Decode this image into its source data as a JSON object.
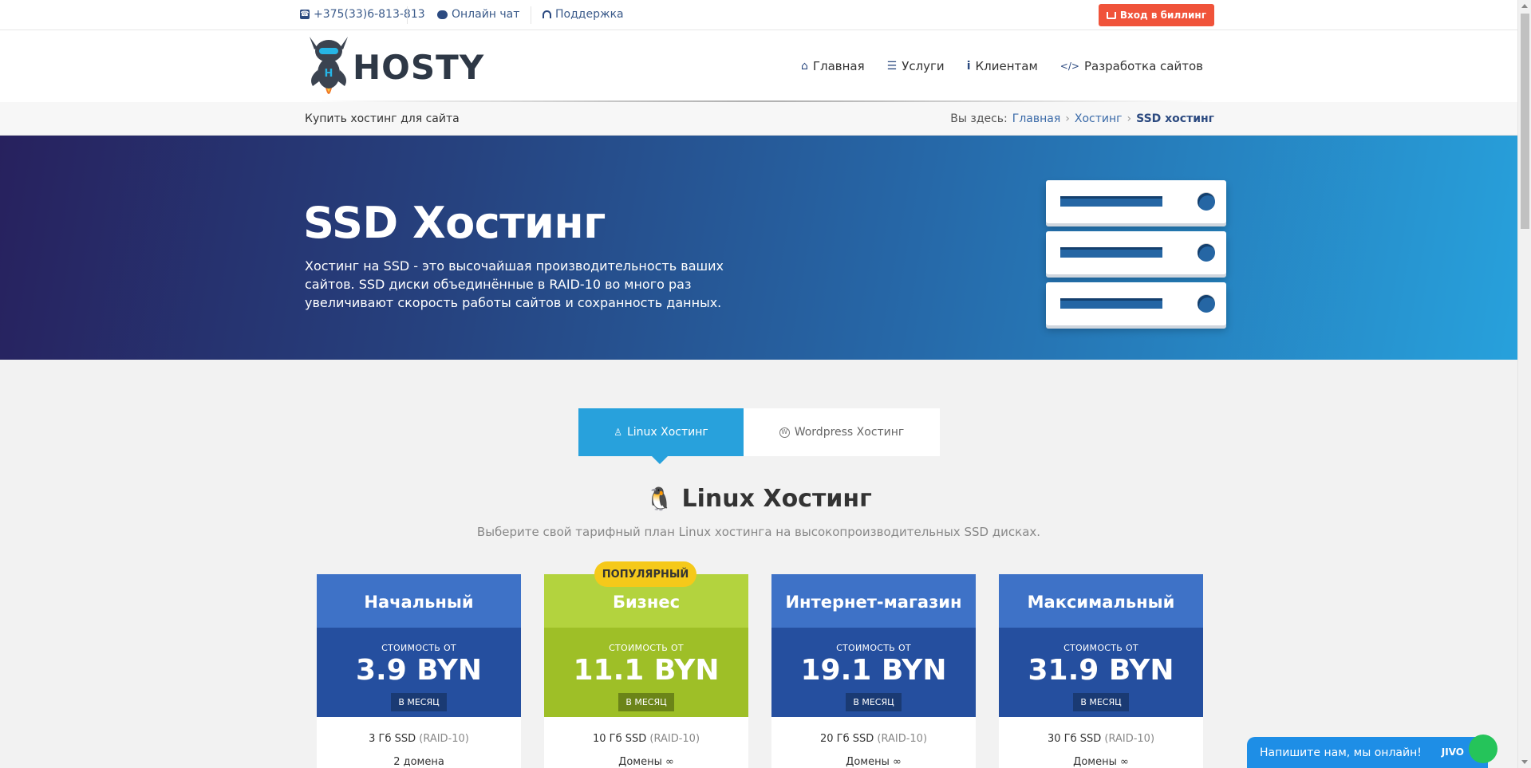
{
  "topbar": {
    "phone": "+375(33)6-813-813",
    "chat": "Онлайн чат",
    "support": "Поддержка",
    "billing": "Вход в биллинг"
  },
  "header": {
    "logo_text": "HOSTY",
    "nav": [
      {
        "label": "Главная",
        "icon": "home-icon"
      },
      {
        "label": "Услуги",
        "icon": "list-icon"
      },
      {
        "label": "Клиентам",
        "icon": "info-icon"
      },
      {
        "label": "Разработка сайтов",
        "icon": "code-icon"
      }
    ]
  },
  "breadcrumb": {
    "page_name": "Купить хостинг для сайта",
    "prefix": "Вы здесь:",
    "items": [
      "Главная",
      "Хостинг",
      "SSD хостинг"
    ]
  },
  "hero": {
    "title": "SSD Хостинг",
    "description": "Хостинг на SSD - это высочайшая производительность ваших сайтов. SSD диски объединённые в RAID-10 во много раз увеличивают скорость работы сайтов и сохранность данных."
  },
  "tabs": [
    {
      "label": "Linux Хостинг",
      "active": true
    },
    {
      "label": "Wordpress Хостинг",
      "active": false
    }
  ],
  "section": {
    "title": "Linux Хостинг",
    "subtitle": "Выберите свой тарифный план Linux хостинга на высокопроизводительных SSD дисках."
  },
  "plans": [
    {
      "name": "Начальный",
      "from": "СТОИМОСТЬ ОТ",
      "price": "3.9 BYN",
      "per": "В МЕСЯЦ",
      "storage": "3 Гб SSD",
      "raid": "(RAID-10)",
      "domains": "2 домена"
    },
    {
      "name": "Бизнес",
      "from": "СТОИМОСТЬ ОТ",
      "price": "11.1 BYN",
      "per": "В МЕСЯЦ",
      "storage": "10 Гб SSD",
      "raid": "(RAID-10)",
      "domains": "Домены ∞",
      "badge": "ПОПУЛЯРНЫЙ"
    },
    {
      "name": "Интернет-магазин",
      "from": "СТОИМОСТЬ ОТ",
      "price": "19.1 BYN",
      "per": "В МЕСЯЦ",
      "storage": "20 Гб SSD",
      "raid": "(RAID-10)",
      "domains": "Домены ∞"
    },
    {
      "name": "Максимальный",
      "from": "СТОИМОСТЬ ОТ",
      "price": "31.9 BYN",
      "per": "В МЕСЯЦ",
      "storage": "30 Гб SSD",
      "raid": "(RAID-10)",
      "domains": "Домены ∞"
    }
  ],
  "chat_widget": {
    "text": "Напишите нам, мы онлайн!",
    "brand": "JIVO"
  },
  "colors": {
    "accent_green": "#a3bf3b",
    "billing_red": "#f0533a",
    "tab_blue": "#28a1dc",
    "plan_blue": "#254f9f",
    "plan_green": "#9ebf27"
  }
}
